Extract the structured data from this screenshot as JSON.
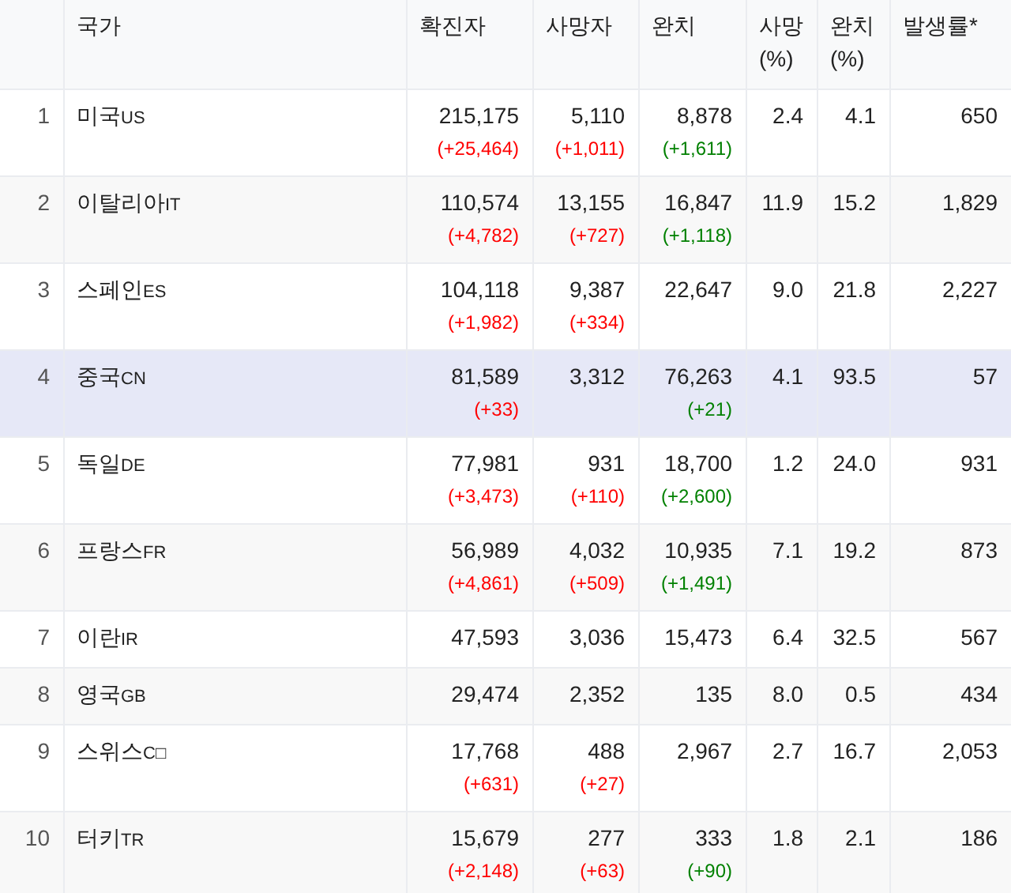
{
  "table": {
    "columns": [
      "국가",
      "확진자",
      "사망자",
      "완치",
      "사망 (%)",
      "완치 (%)",
      "발생률*"
    ],
    "rows": [
      {
        "rank": "1",
        "country": "미국",
        "code": "US",
        "confirmed": "215,175",
        "confirmed_change": "(+25,464)",
        "deaths": "5,110",
        "deaths_change": "(+1,011)",
        "recovered": "8,878",
        "recovered_change": "(+1,611)",
        "death_pct": "2.4",
        "recovery_pct": "4.1",
        "rate": "650",
        "selected": false
      },
      {
        "rank": "2",
        "country": "이탈리아",
        "code": "IT",
        "confirmed": "110,574",
        "confirmed_change": "(+4,782)",
        "deaths": "13,155",
        "deaths_change": "(+727)",
        "recovered": "16,847",
        "recovered_change": "(+1,118)",
        "death_pct": "11.9",
        "recovery_pct": "15.2",
        "rate": "1,829",
        "selected": false
      },
      {
        "rank": "3",
        "country": "스페인",
        "code": "ES",
        "confirmed": "104,118",
        "confirmed_change": "(+1,982)",
        "deaths": "9,387",
        "deaths_change": "(+334)",
        "recovered": "22,647",
        "death_pct": "9.0",
        "recovery_pct": "21.8",
        "rate": "2,227",
        "selected": false
      },
      {
        "rank": "4",
        "country": "중국",
        "code": "CN",
        "confirmed": "81,589",
        "confirmed_change": "(+33)",
        "deaths": "3,312",
        "recovered": "76,263",
        "recovered_change": "(+21)",
        "death_pct": "4.1",
        "recovery_pct": "93.5",
        "rate": "57",
        "selected": true
      },
      {
        "rank": "5",
        "country": "독일",
        "code": "DE",
        "confirmed": "77,981",
        "confirmed_change": "(+3,473)",
        "deaths": "931",
        "deaths_change": "(+110)",
        "recovered": "18,700",
        "recovered_change": "(+2,600)",
        "death_pct": "1.2",
        "recovery_pct": "24.0",
        "rate": "931",
        "selected": false
      },
      {
        "rank": "6",
        "country": "프랑스",
        "code": "FR",
        "confirmed": "56,989",
        "confirmed_change": "(+4,861)",
        "deaths": "4,032",
        "deaths_change": "(+509)",
        "recovered": "10,935",
        "recovered_change": "(+1,491)",
        "death_pct": "7.1",
        "recovery_pct": "19.2",
        "rate": "873",
        "selected": false
      },
      {
        "rank": "7",
        "country": "이란",
        "code": "IR",
        "confirmed": "47,593",
        "deaths": "3,036",
        "recovered": "15,473",
        "death_pct": "6.4",
        "recovery_pct": "32.5",
        "rate": "567",
        "selected": false
      },
      {
        "rank": "8",
        "country": "영국",
        "code": "GB",
        "confirmed": "29,474",
        "deaths": "2,352",
        "recovered": "135",
        "death_pct": "8.0",
        "recovery_pct": "0.5",
        "rate": "434",
        "selected": false
      },
      {
        "rank": "9",
        "country": "스위스",
        "code": "C□",
        "confirmed": "17,768",
        "confirmed_change": "(+631)",
        "deaths": "488",
        "deaths_change": "(+27)",
        "recovered": "2,967",
        "death_pct": "2.7",
        "recovery_pct": "16.7",
        "rate": "2,053",
        "selected": false
      },
      {
        "rank": "10",
        "country": "터키",
        "code": "TR",
        "confirmed": "15,679",
        "confirmed_change": "(+2,148)",
        "deaths": "277",
        "deaths_change": "(+63)",
        "recovered": "333",
        "recovered_change": "(+90)",
        "death_pct": "1.8",
        "recovery_pct": "2.1",
        "rate": "186",
        "selected": false
      }
    ]
  }
}
